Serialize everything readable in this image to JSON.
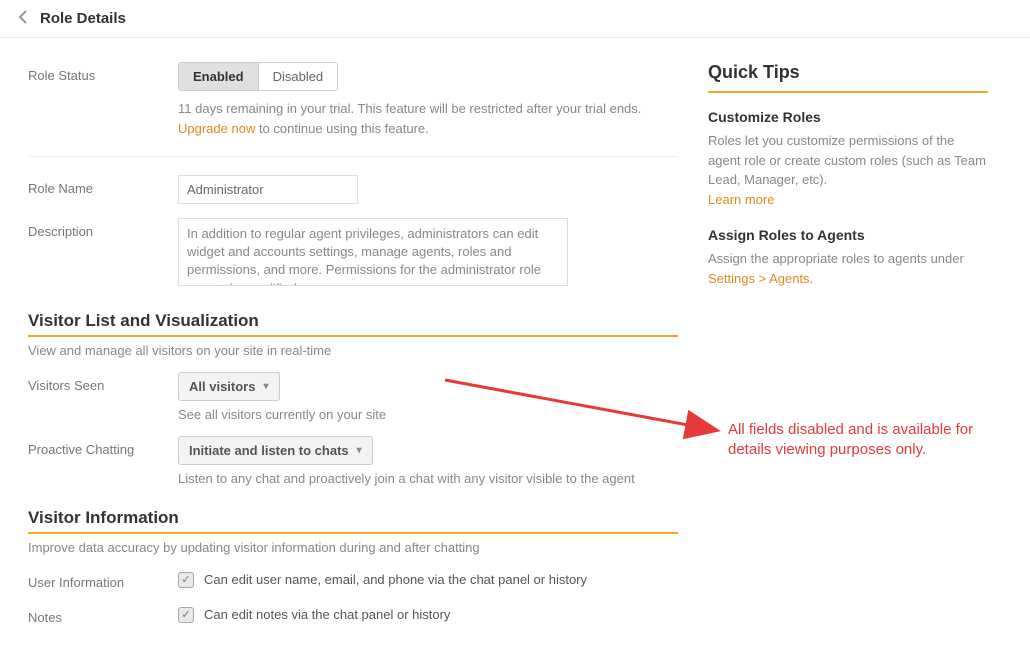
{
  "header": {
    "title": "Role Details"
  },
  "roleStatus": {
    "label": "Role Status",
    "enabled": "Enabled",
    "disabled": "Disabled",
    "trialLine": "11 days remaining in your trial. This feature will be restricted after your trial ends.",
    "upgradeLink": "Upgrade now",
    "upgradeTail": " to continue using this feature."
  },
  "roleName": {
    "label": "Role Name",
    "value": "Administrator"
  },
  "description": {
    "label": "Description",
    "value": "In addition to regular agent privileges, administrators can edit widget and accounts settings, manage agents, roles and permissions, and more. Permissions for the administrator role cannot be modified."
  },
  "sections": {
    "visitorList": {
      "title": "Visitor List and Visualization",
      "sub": "View and manage all visitors on your site in real-time",
      "visitorsSeen": {
        "label": "Visitors Seen",
        "value": "All visitors",
        "help": "See all visitors currently on your site"
      },
      "proactive": {
        "label": "Proactive Chatting",
        "value": "Initiate and listen to chats",
        "help": "Listen to any chat and proactively join a chat with any visitor visible to the agent"
      }
    },
    "visitorInfo": {
      "title": "Visitor Information",
      "sub": "Improve data accuracy by updating visitor information during and after chatting",
      "userInfo": {
        "label": "User Information",
        "text": "Can edit user name, email, and phone via the chat panel or history"
      },
      "notes": {
        "label": "Notes",
        "text": "Can edit notes via the chat panel or history"
      }
    }
  },
  "aside": {
    "title": "Quick Tips",
    "customize": {
      "title": "Customize Roles",
      "body": "Roles let you customize permissions of the agent role or create custom roles (such as Team Lead, Manager, etc).",
      "link": "Learn more"
    },
    "assign": {
      "title": "Assign Roles to Agents",
      "body": "Assign the appropriate roles to agents under ",
      "link": "Settings > Agents"
    }
  },
  "annotation": {
    "text": "All fields disabled and is available for details viewing purposes only."
  }
}
